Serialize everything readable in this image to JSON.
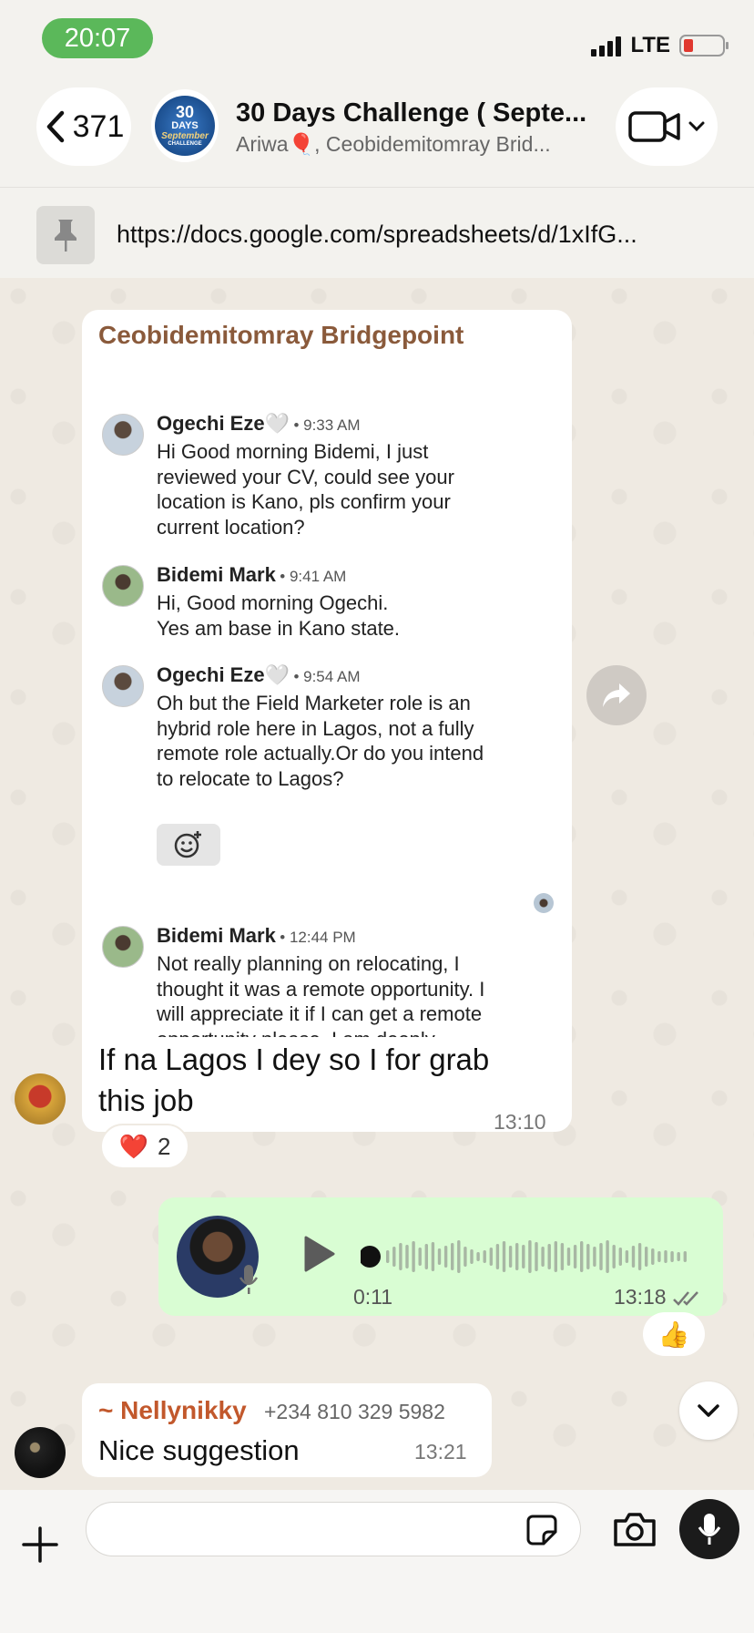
{
  "status_bar": {
    "time": "20:07",
    "network": "LTE"
  },
  "header": {
    "back_count": "371",
    "group_avatar_lines": [
      "30",
      "DAYS",
      "September",
      "CHALLENGE"
    ],
    "title": "30 Days Challenge ( Septe...",
    "subtitle": "Ariwa🎈, Ceobidemitomray Brid..."
  },
  "pinned": {
    "url": "https://docs.google.com/spreadsheets/d/1xIfG..."
  },
  "messages": {
    "main": {
      "sender": "Ceobidemitomray Bridgepoint",
      "screenshot": [
        {
          "name": "Ogechi Eze🤍",
          "time": "• 9:33 AM",
          "body": "Hi Good morning Bidemi, I just\nreviewed your CV, could see your\nlocation is Kano, pls confirm your\ncurrent location?"
        },
        {
          "name": "Bidemi Mark",
          "time": "• 9:41 AM",
          "body": "Hi, Good morning Ogechi.\nYes am base in Kano state."
        },
        {
          "name": "Ogechi Eze🤍",
          "time": "• 9:54 AM",
          "body": "Oh but the Field Marketer role is an\nhybrid role here in Lagos, not a fully\nremote role actually.Or do you intend\nto relocate to Lagos?"
        },
        {
          "name": "Bidemi Mark",
          "time": "• 12:44 PM",
          "body": "Not really planning on relocating, I\nthought it was a remote opportunity. I\nwill appreciate it if I can get a remote\nopportunity please. I am deeply\ngrateful for your swift response"
        }
      ],
      "caption": "If na Lagos I dey so I for grab this job",
      "time": "13:10",
      "reaction_emoji": "❤️",
      "reaction_count": "2"
    },
    "voice": {
      "duration": "0:11",
      "time": "13:18",
      "reaction": "👍",
      "played_fraction": 0
    },
    "last": {
      "sender": "~ Nellynikky",
      "phone": "+234 810 329 5982",
      "text": "Nice suggestion",
      "time": "13:21"
    }
  },
  "composer": {
    "placeholder": ""
  },
  "colors": {
    "chat_bg": "#efeae2",
    "outgoing_bubble": "#d9fdd3",
    "status_time_pill": "#5bb85a",
    "sender_name_brown": "#8a5a3b",
    "sender_name_orange": "#c2582c"
  },
  "icons": [
    "chevron-left-icon",
    "video-camera-icon",
    "chevron-down-icon",
    "pin-icon",
    "forward-icon",
    "play-icon",
    "mic-icon",
    "plus-icon",
    "sticker-icon",
    "camera-icon",
    "add-reaction-icon",
    "double-check-icon"
  ]
}
